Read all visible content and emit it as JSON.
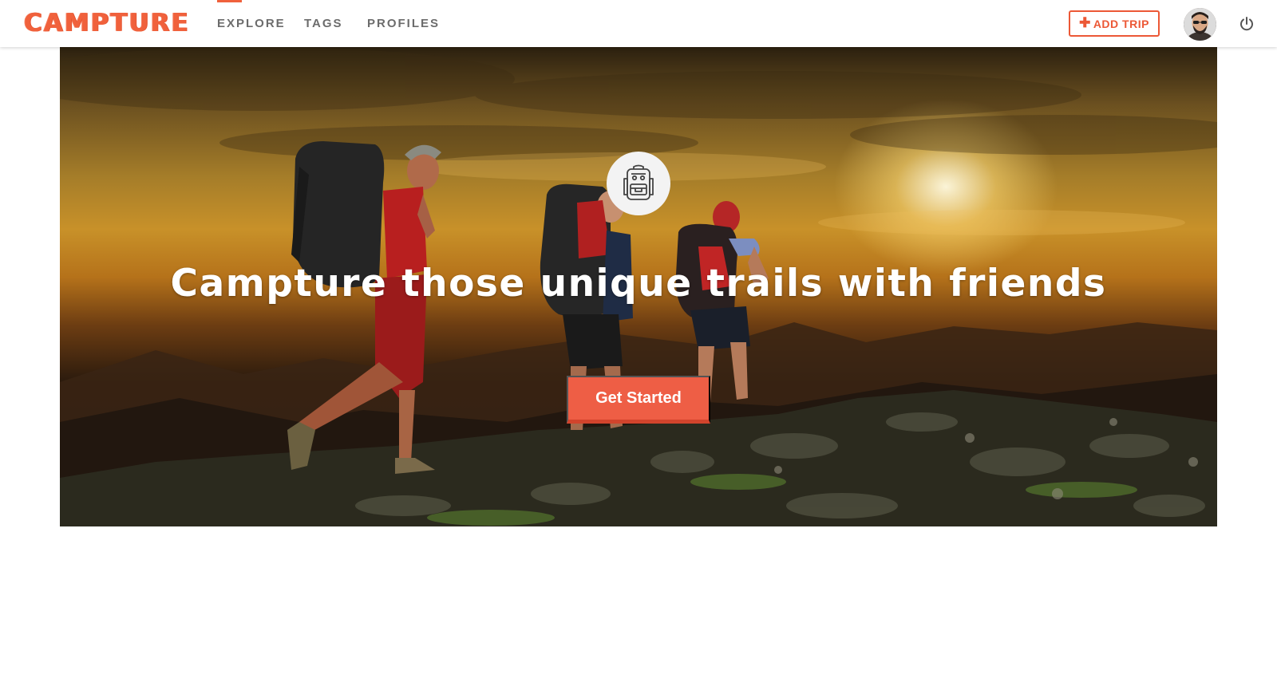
{
  "brand": {
    "name": "CAMPTURE",
    "accent_color": "#f0613c"
  },
  "nav": {
    "items": [
      {
        "label": "EXPLORE",
        "active": true
      },
      {
        "label": "TAGS",
        "active": false
      },
      {
        "label": "PROFILES",
        "active": false
      }
    ]
  },
  "header": {
    "add_trip": {
      "icon": "plus-icon",
      "label": "ADD TRIP"
    },
    "avatar": "user-avatar",
    "logout_icon": "power-icon"
  },
  "hero": {
    "badge_icon": "backpack-icon",
    "title": "Campture those unique trails with friends",
    "cta_label": "Get Started",
    "cta_color": "#ee5e45"
  }
}
